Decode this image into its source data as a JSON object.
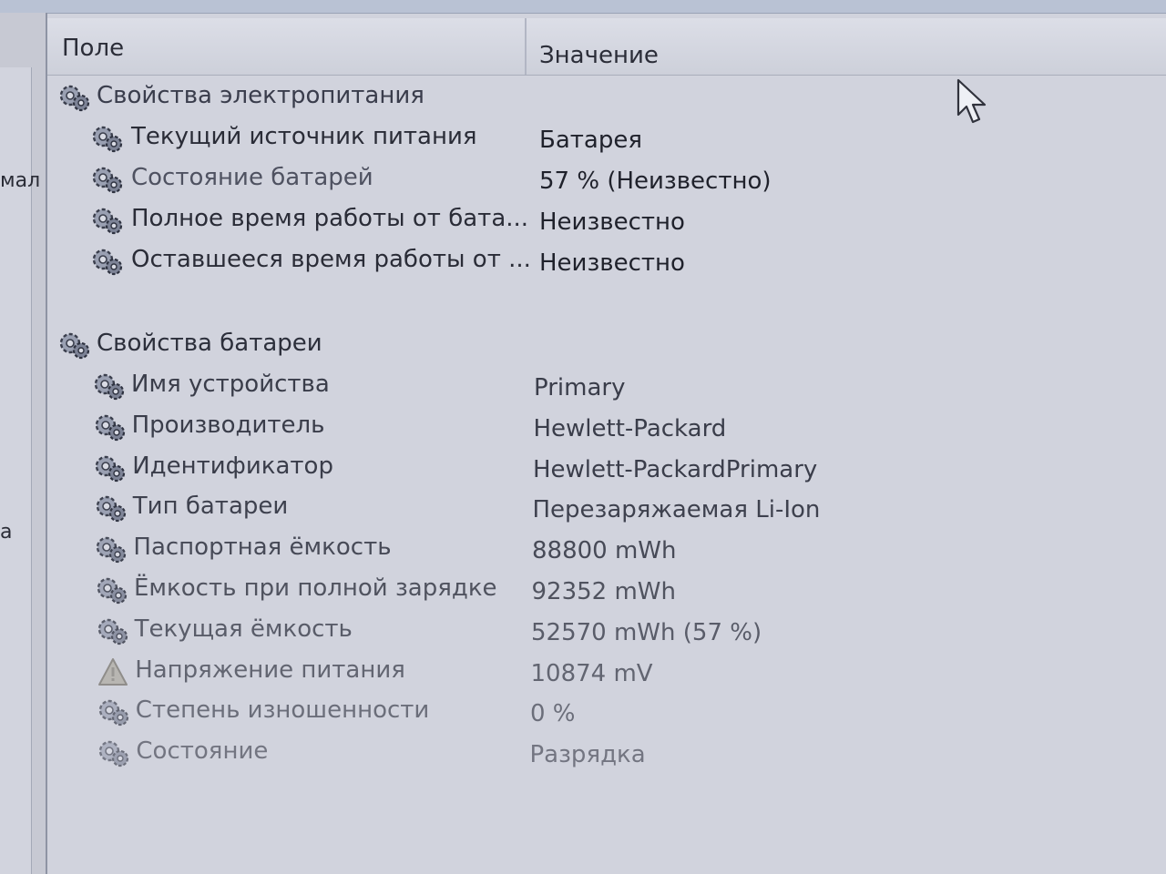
{
  "columns": {
    "field_label": "Поле",
    "value_label": "Значение"
  },
  "left_fragments": [
    "мал",
    "а"
  ],
  "groups": [
    {
      "title": "Свойства электропитания",
      "icon": "battery-properties-icon",
      "rows": [
        {
          "field": "Текущий источник питания",
          "value": "Батарея",
          "icon": "battery-properties-icon"
        },
        {
          "field": "Состояние батарей",
          "value": "57 % (Неизвестно)",
          "icon": "battery-properties-icon"
        },
        {
          "field": "Полное время работы от бата...",
          "value": "Неизвестно",
          "icon": "battery-properties-icon"
        },
        {
          "field": "Оставшееся время работы от ...",
          "value": "Неизвестно",
          "icon": "battery-properties-icon"
        }
      ]
    },
    {
      "title": "Свойства батареи",
      "icon": "battery-properties-icon",
      "rows": [
        {
          "field": "Имя устройства",
          "value": "Primary",
          "icon": "battery-properties-icon"
        },
        {
          "field": "Производитель",
          "value": "Hewlett-Packard",
          "icon": "battery-properties-icon"
        },
        {
          "field": "Идентификатор",
          "value": "Hewlett-PackardPrimary",
          "icon": "battery-properties-icon"
        },
        {
          "field": "Тип батареи",
          "value": "Перезаряжаемая Li-Ion",
          "icon": "battery-properties-icon"
        },
        {
          "field": "Паспортная ёмкость",
          "value": "88800 mWh",
          "icon": "battery-properties-icon"
        },
        {
          "field": "Ёмкость при полной зарядке",
          "value": "92352 mWh",
          "icon": "battery-properties-icon"
        },
        {
          "field": "Текущая ёмкость",
          "value": "52570 mWh  (57 %)",
          "icon": "battery-properties-icon"
        },
        {
          "field": "Напряжение питания",
          "value": "10874 mV",
          "icon": "warning-triangle-icon"
        },
        {
          "field": "Степень изношенности",
          "value": "0 %",
          "icon": "battery-properties-icon"
        },
        {
          "field": "Состояние",
          "value": "Разрядка",
          "icon": "battery-properties-icon"
        }
      ]
    }
  ],
  "colors": {
    "text_dark": "#23252f",
    "text_mid": "#4a4d5a",
    "text_faded": "#6c6f7c",
    "background": "#d1d3dd"
  }
}
